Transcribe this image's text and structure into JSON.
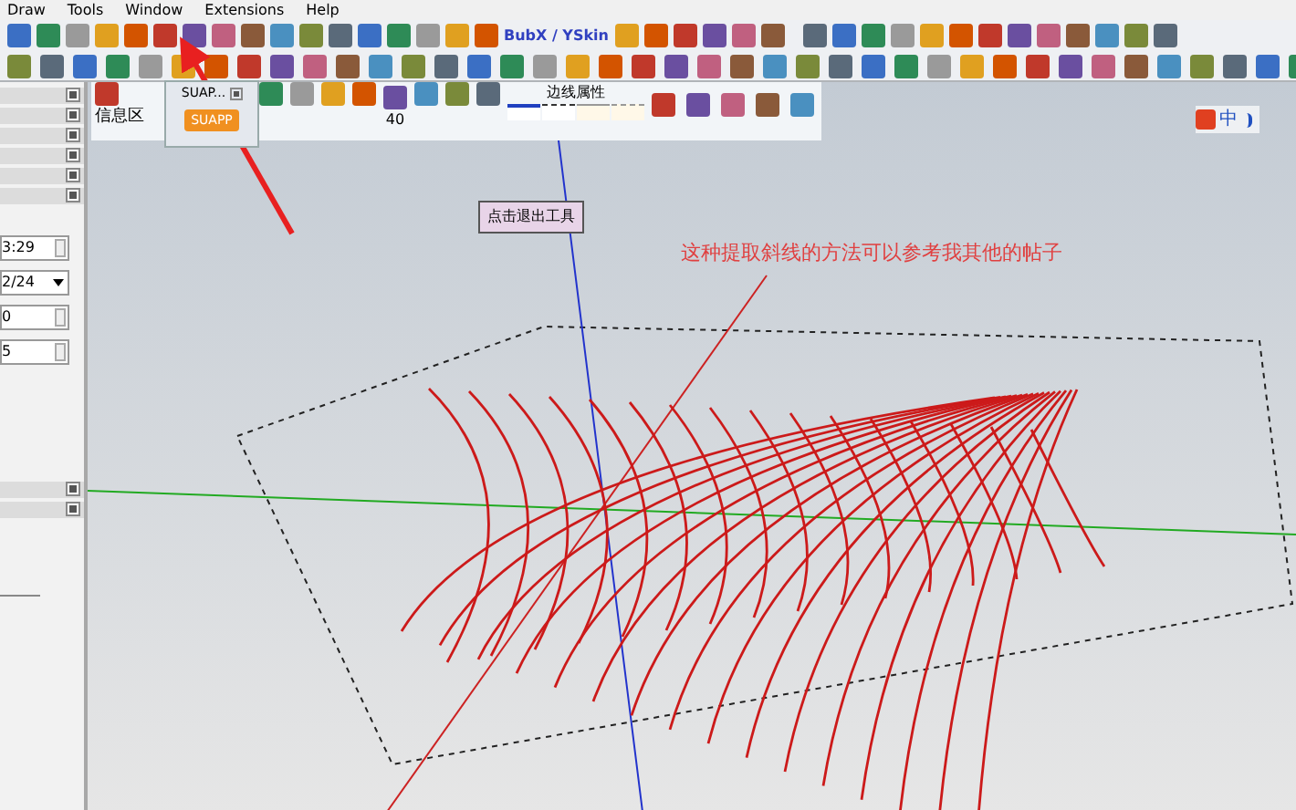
{
  "menu_bar": [
    "Draw",
    "Tools",
    "Window",
    "Extensions",
    "Help"
  ],
  "toolbar_label": "BubX / YSkin",
  "left_panel": {
    "fields": [
      {
        "kind": "spin",
        "value": "3:29"
      },
      {
        "kind": "dropdown",
        "value": "2/24"
      },
      {
        "kind": "spin",
        "value": "0"
      },
      {
        "kind": "spin",
        "value": "5"
      }
    ]
  },
  "float_toolbar": {
    "info_label": "信息区",
    "number": "40",
    "edge_title": "边线属性"
  },
  "suapp_panel": {
    "title": "SUAP...",
    "button": "SUAPP"
  },
  "tooltip": "点击退出工具",
  "annotation": "这种提取斜线的方法可以参考我其他的帖子",
  "ime": {
    "label": "中"
  }
}
